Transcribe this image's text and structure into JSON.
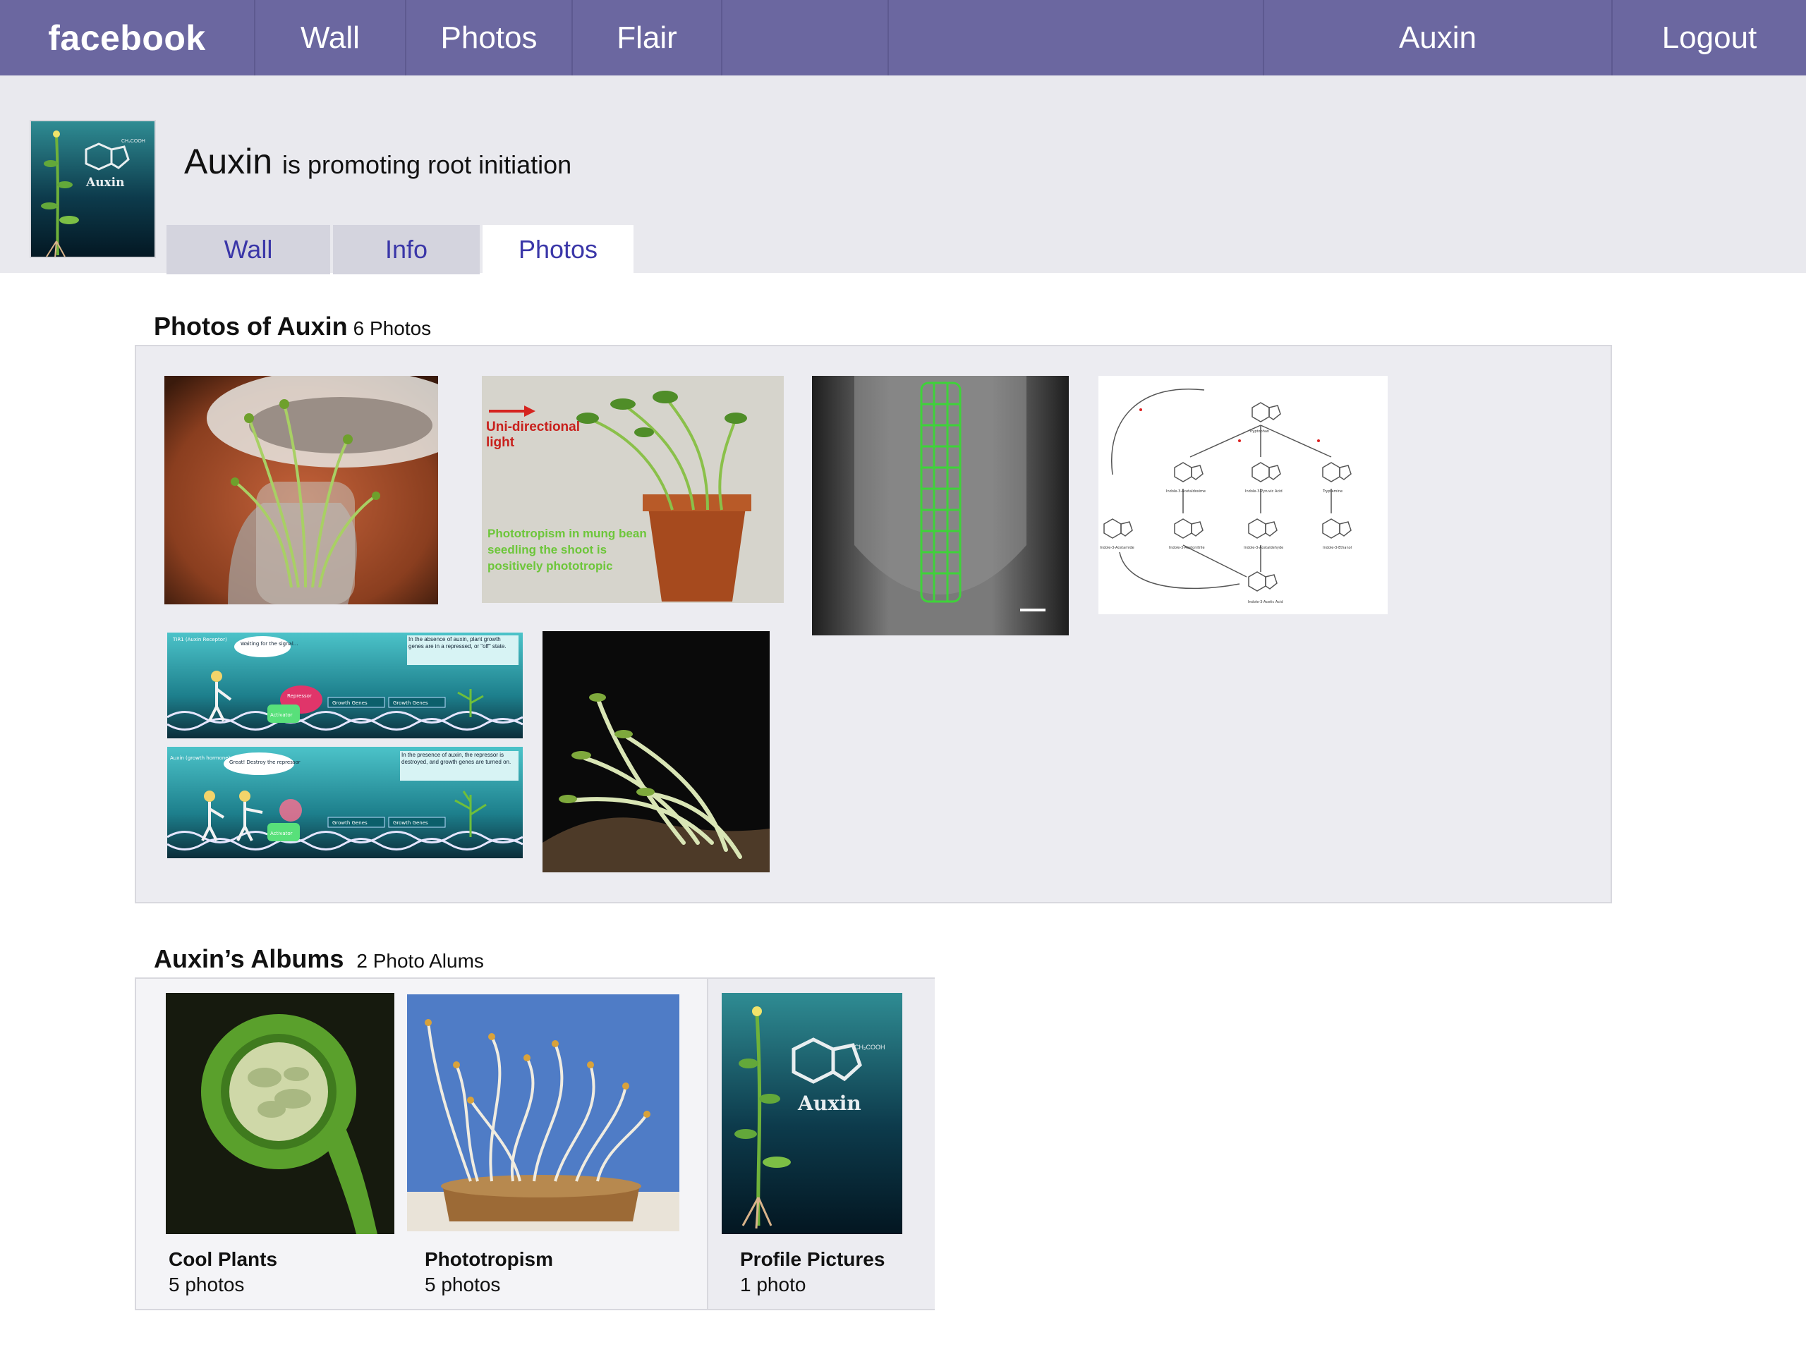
{
  "nav": {
    "logo": "facebook",
    "items": [
      "Wall",
      "Photos",
      "Flair"
    ],
    "user": "Auxin",
    "logout": "Logout"
  },
  "profile": {
    "name": "Auxin",
    "status": "is promoting root initiation",
    "avatar_text": "Auxin",
    "avatar_formula": "CH₂COOH"
  },
  "tabs": [
    "Wall",
    "Info",
    "Photos"
  ],
  "active_tab": "Photos",
  "photos": {
    "title": "Photos of Auxin",
    "count": "6 Photos",
    "phototropism_caption": {
      "arrow_label": "Uni-directional light",
      "text": "Phototropism in mung bean seedling the shoot is positively phototropic"
    },
    "pathway_labels": [
      "Tryptophan",
      "Indole-3-Acetaldoxime",
      "Indole-3-Pyruvic Acid",
      "Tryptamine",
      "Indole-3-Acetamide",
      "Indole-3-Acetonitrile",
      "Indole-3-Acetaldehyde",
      "Indole-3-Ethanol",
      "Indole-3-Acetic Acid"
    ],
    "signal_panel": {
      "top_note": "In the absence of auxin, plant growth genes are in a repressed, or \"off\" state.",
      "top_bubble": "Waiting for the signal...",
      "bottom_note": "In the presence of auxin, the repressor is destroyed, and growth genes are turned on.",
      "bottom_bubble": "Great! Destroy the repressor",
      "tir1": "TIR1 (Auxin Receptor)",
      "repressor": "Repressor",
      "activator": "Activator",
      "genes": "Growth Genes",
      "auxin": "Auxin (growth hormone)"
    }
  },
  "albums": {
    "title": "Auxin’s Albums",
    "count": "2 Photo Alums",
    "items": [
      {
        "name": "Cool Plants",
        "count": "5 photos"
      },
      {
        "name": "Phototropism",
        "count": "5 photos"
      },
      {
        "name": "Profile Pictures",
        "count": "1 photo"
      }
    ]
  },
  "colors": {
    "nav_bg": "#6b67a0",
    "band_bg": "#e9e9ee",
    "tab_text": "#3a36a8",
    "box_bg": "#ececf1"
  }
}
